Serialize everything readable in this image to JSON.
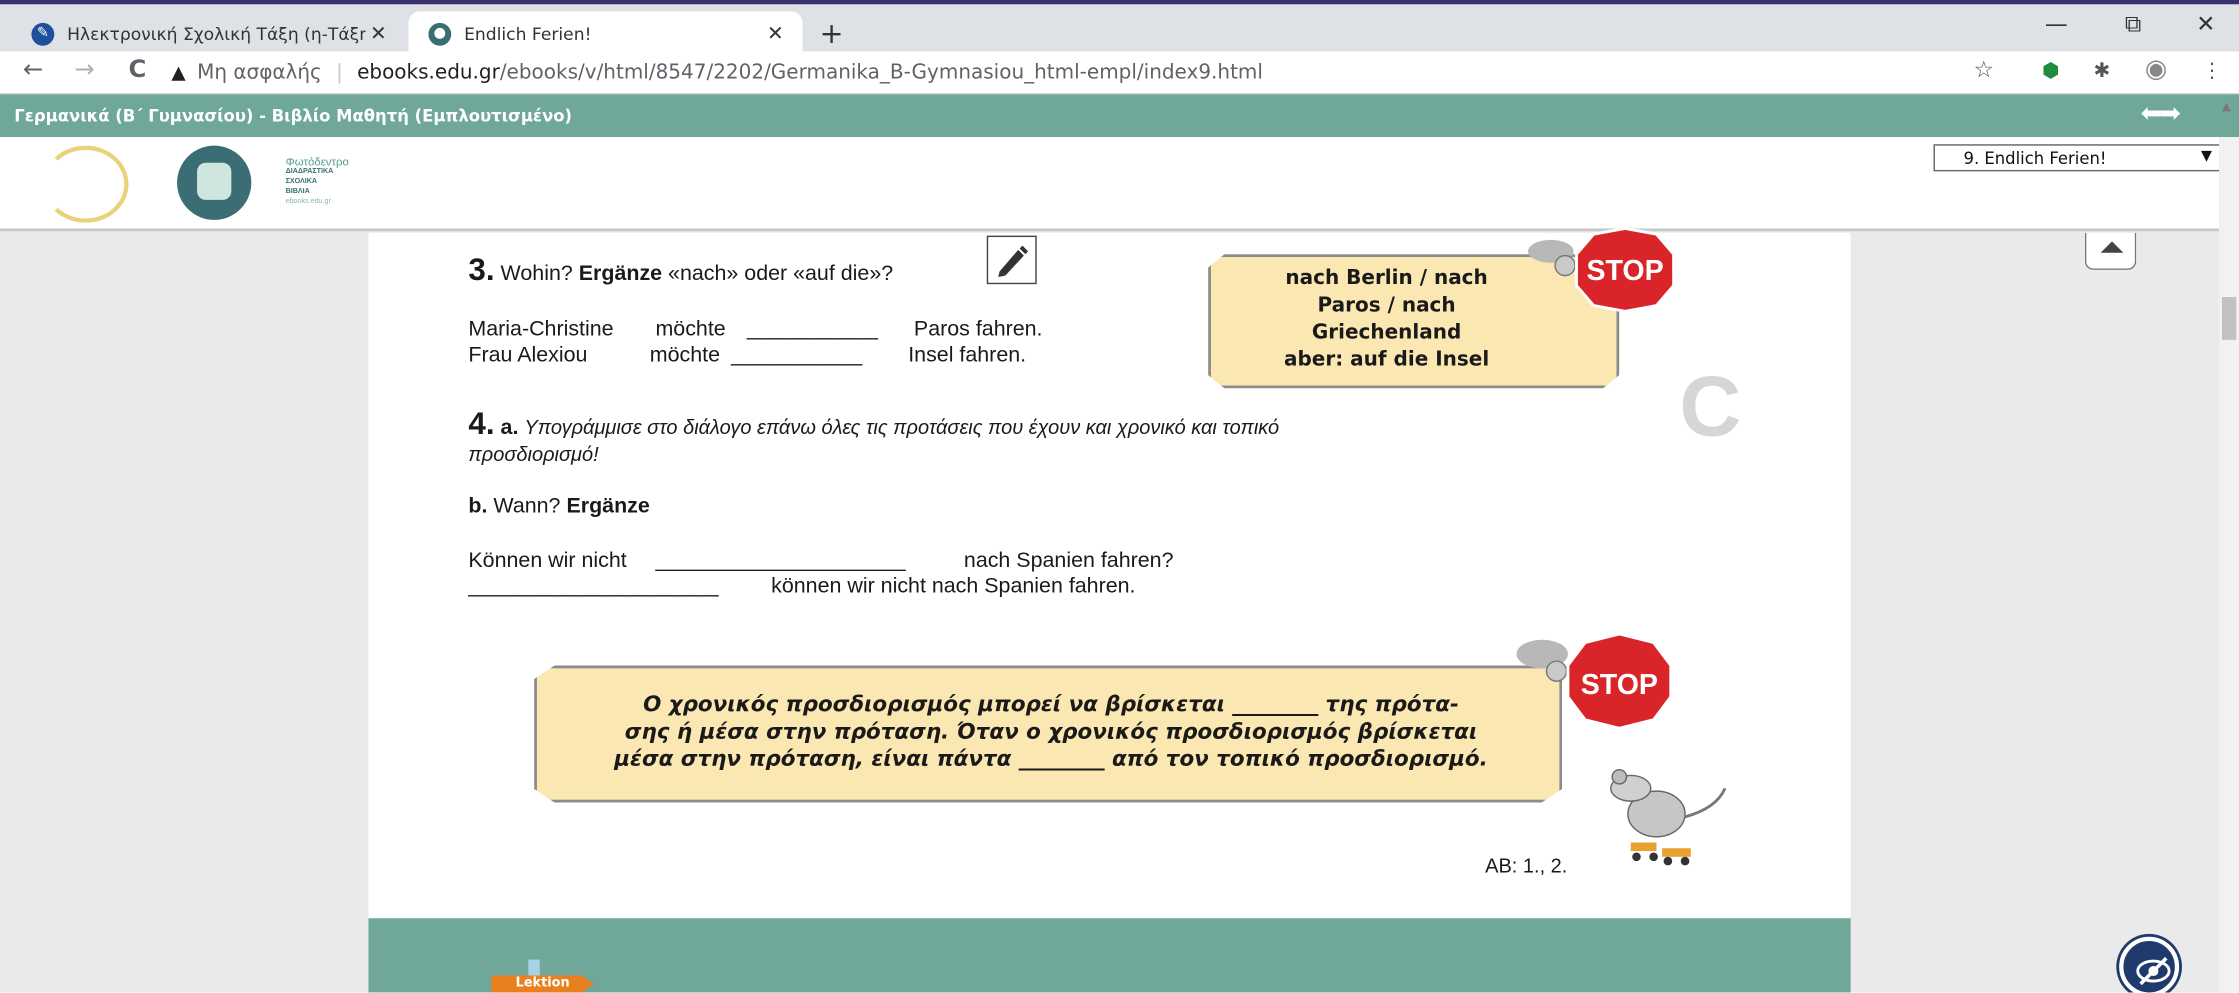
{
  "browser": {
    "tabs": [
      {
        "title": "Ηλεκτρονική Σχολική Τάξη (η-Τάξη)",
        "active": false
      },
      {
        "title": "Endlich Ferien!",
        "active": true
      }
    ],
    "new_tab": "+",
    "close": "✕",
    "window_controls": {
      "minimize": "—",
      "restore": "⧉",
      "close": "✕"
    },
    "nav": {
      "back": "←",
      "forward": "→",
      "reload": "C"
    },
    "address": {
      "warning_icon": "▲",
      "security_text": "Μη ασφαλής",
      "separator": "|",
      "host": "ebooks.edu.gr",
      "path": "/ebooks/v/html/8547/2202/Germanika_B-Gymnasiou_html-empl/index9.html"
    },
    "icons": {
      "bookmark": "☆",
      "ext1": "⬢",
      "ext2": "✱",
      "profile": "◉",
      "menu": "⋮"
    }
  },
  "site": {
    "title": "Γερμανικά (Β΄ Γυμνασίου) - Βιβλίο Μαθητή (Εμπλουτισμένο)",
    "logo_text": {
      "name": "Φωτόδεντρο",
      "sub1": "ΔΙΑΔΡΑΣΤΙΚΑ",
      "sub2": "ΣΧΟΛΙΚΑ",
      "sub3": "ΒΙΒΛΙΑ",
      "url": "ebooks.edu.gr"
    },
    "chapter_select": "9. Endlich Ferien!",
    "nav_arrows": "⬅➡"
  },
  "exercise3": {
    "number": "3.",
    "prompt_a": "Wohin?",
    "prompt_b": "Ergänze",
    "prompt_c": "«nach» oder «auf die»?",
    "lines": [
      {
        "name": "Maria-Christine",
        "verb": "möchte",
        "blank": "___________",
        "rest": "Paros fahren."
      },
      {
        "name": "Frau Alexiou",
        "verb": "möchte",
        "blank": "___________",
        "rest": "Insel fahren."
      }
    ]
  },
  "stop1": {
    "lines": [
      "nach Berlin / nach",
      "Paros / nach",
      "Griechenland",
      "aber: auf die Insel"
    ],
    "sign": "STOP"
  },
  "section_letter": "C",
  "exercise4": {
    "number": "4.",
    "a_label": "a.",
    "a_text_1": "Υπογράμμισε στο διάλογο επάνω όλες τις προτάσεις που έχουν και χρονικό και τοπικό",
    "a_text_2": "προσδιορισμό!",
    "b_label": "b.",
    "b_prompt": "Wann?",
    "b_bold": "Ergänze",
    "line1_a": "Können wir nicht",
    "line1_blank": "_____________________",
    "line1_b": "nach Spanien fahren?",
    "line2_blank": "_____________________",
    "line2_b": "können wir nicht nach Spanien fahren."
  },
  "stop2": {
    "line1": "Ο χρονικός προσδιορισμός μπορεί να βρίσκεται ________ της πρότα-",
    "line2": "σης ή μέσα στην πρόταση. Όταν ο χρονικός προσδιορισμός βρίσκεται",
    "line3": "μέσα στην πρόταση, είναι πάντα ________ από τον τοπικό προσδιορισμό.",
    "sign": "STOP"
  },
  "ab_ref": "AB: 1., 2.",
  "footer": {
    "lektion": "Lektion"
  }
}
